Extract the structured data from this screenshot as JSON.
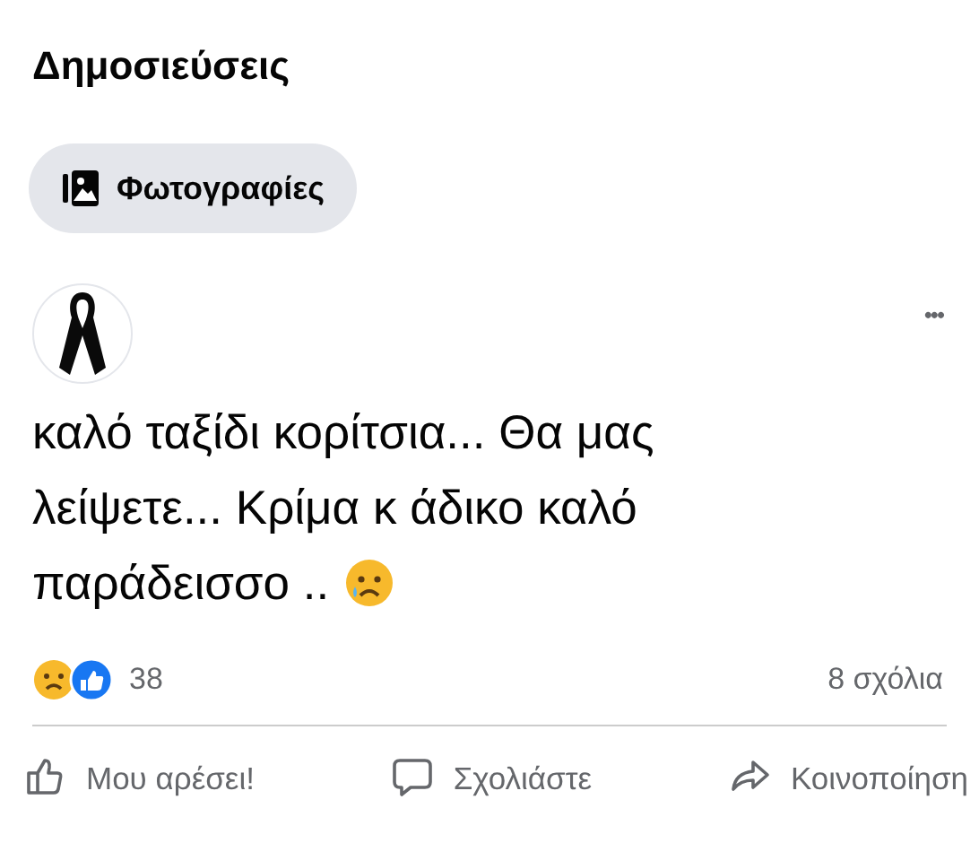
{
  "section_title": "Δημοσιεύσεις",
  "filter_chip": {
    "label": "Φωτογραφίες"
  },
  "post": {
    "more_button": "•••",
    "text_lines": [
      "καλό ταξίδι κορίτσια... Θα μας",
      "λείψετε... Κρίμα  κ άδικο καλό",
      "παράδεισσο .."
    ],
    "reaction_count": "38",
    "comments": "8 σχόλια",
    "actions": [
      {
        "kind": "like",
        "label": "Μου αρέσει!"
      },
      {
        "kind": "comment",
        "label": "Σχολιάστε"
      },
      {
        "kind": "share",
        "label": "Κοινοποίηση"
      }
    ]
  }
}
